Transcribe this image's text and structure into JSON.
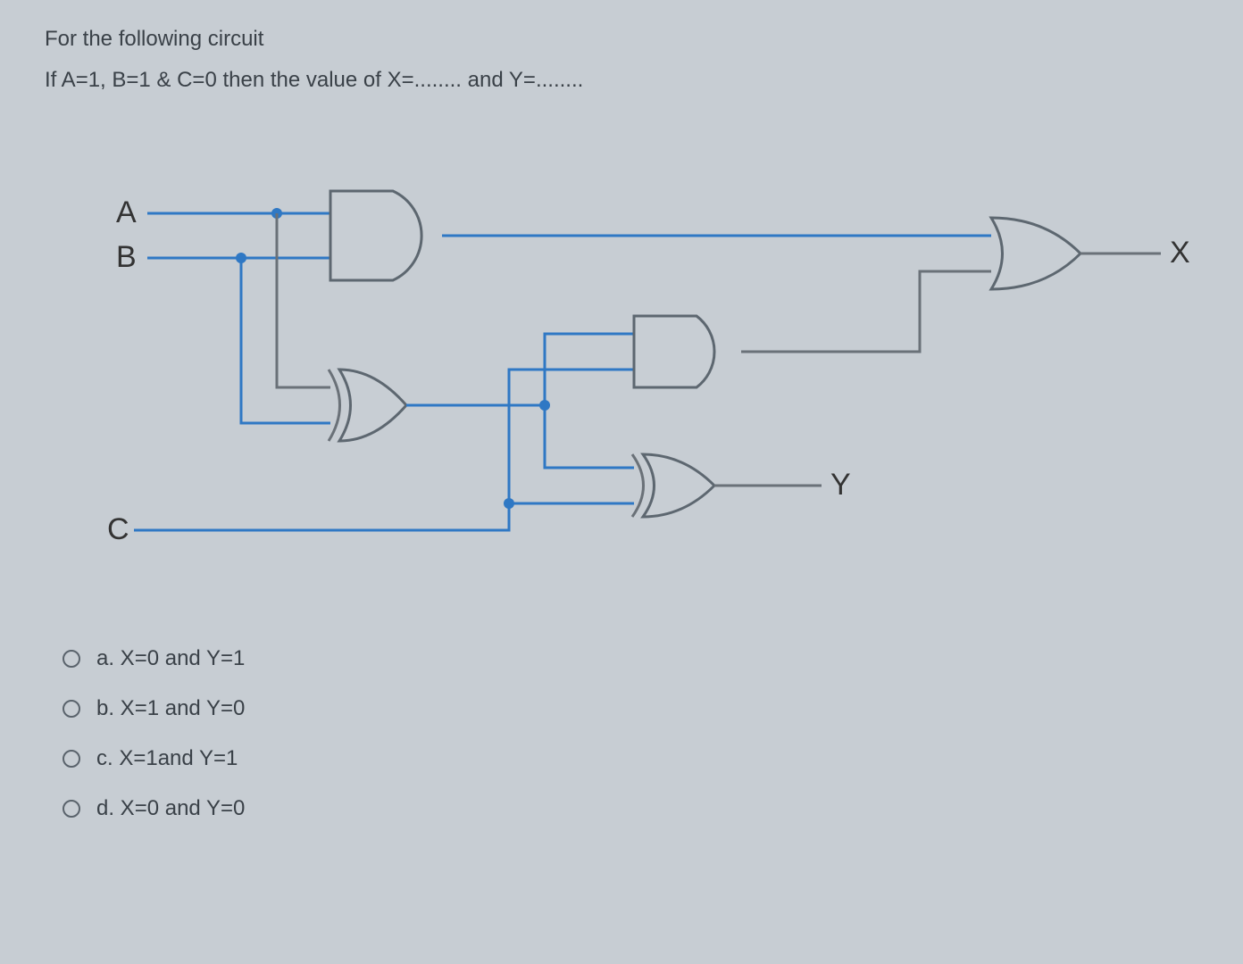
{
  "question": {
    "line1": "For the following circuit",
    "line2": "If A=1, B=1 & C=0 then the value of X=........ and Y=........"
  },
  "circuit": {
    "inputs": {
      "A": "A",
      "B": "B",
      "C": "C"
    },
    "outputs": {
      "X": "X",
      "Y": "Y"
    },
    "gates": [
      {
        "id": "G1",
        "type": "AND",
        "inputs": [
          "A",
          "B"
        ]
      },
      {
        "id": "G2",
        "type": "XOR",
        "inputs": [
          "A",
          "B"
        ]
      },
      {
        "id": "G3",
        "type": "AND",
        "inputs": [
          "G2",
          "C"
        ]
      },
      {
        "id": "G4",
        "type": "XOR",
        "inputs": [
          "G2",
          "C"
        ],
        "output": "Y"
      },
      {
        "id": "G5",
        "type": "OR",
        "inputs": [
          "G1",
          "G3"
        ],
        "output": "X"
      }
    ]
  },
  "options": [
    {
      "key": "a",
      "label": "a. X=0 and Y=1"
    },
    {
      "key": "b",
      "label": "b. X=1 and Y=0"
    },
    {
      "key": "c",
      "label": "c. X=1and Y=1"
    },
    {
      "key": "d",
      "label": "d. X=0 and Y=0"
    }
  ]
}
